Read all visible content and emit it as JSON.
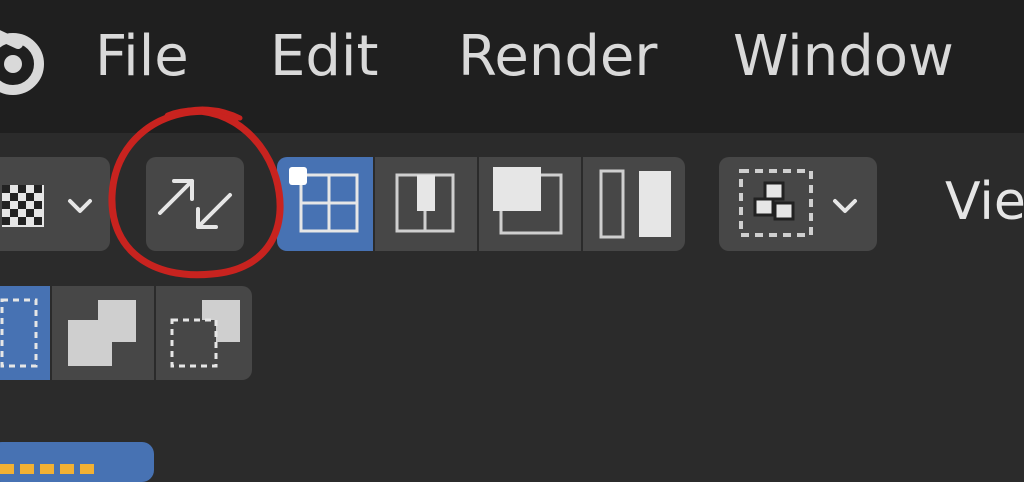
{
  "menubar": {
    "items": [
      {
        "label": "File"
      },
      {
        "label": "Edit"
      },
      {
        "label": "Render"
      },
      {
        "label": "Window"
      }
    ]
  },
  "toolbar": {
    "view_label": "Vie",
    "active_layout": "layout-1"
  },
  "icons": {
    "app_logo": "blender-logo-icon",
    "shading": "checker-shading-icon",
    "sync": "swap-arrows-icon",
    "selection": "selection-mode-icon"
  },
  "colors": {
    "menubar_bg": "#1f1f1f",
    "toolbar_bg": "#2b2b2b",
    "button_bg": "#474747",
    "active_blue": "#4772b3",
    "annotation_red": "#c8231f",
    "text": "#d9d9d9"
  }
}
